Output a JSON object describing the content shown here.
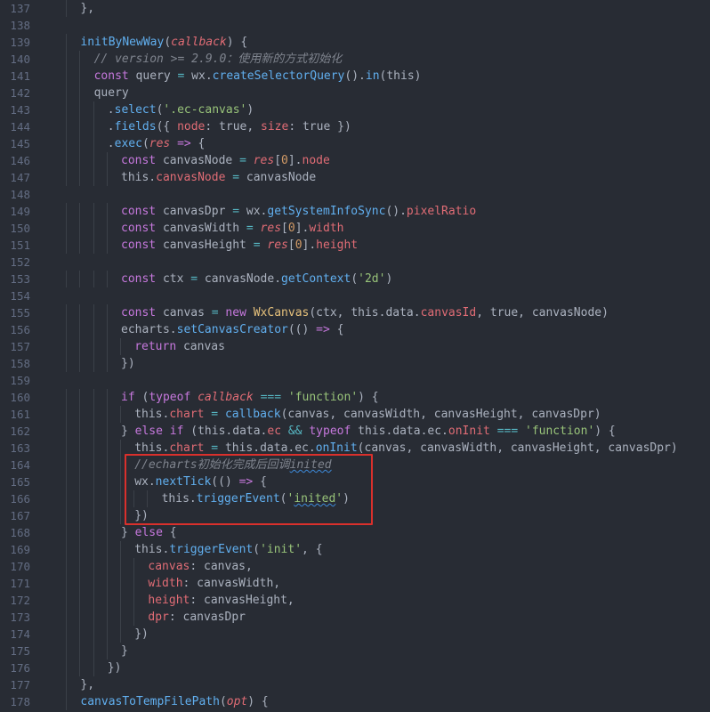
{
  "colors": {
    "background": "#282c34",
    "line_number": "#636d83",
    "keyword": "#c678dd",
    "function": "#61afef",
    "property": "#e06c75",
    "string": "#98c379",
    "number": "#d19a66",
    "comment": "#7f848e",
    "highlight_box": "#d9302c"
  },
  "lines": [
    {
      "n": "137",
      "indent": 2,
      "tokens": [
        [
          "default",
          "},"
        ]
      ]
    },
    {
      "n": "138",
      "indent": 0,
      "tokens": []
    },
    {
      "n": "139",
      "indent": 2,
      "tokens": [
        [
          "function",
          "initByNewWay"
        ],
        [
          "default",
          "("
        ],
        [
          "param",
          "callback"
        ],
        [
          "default",
          ") {"
        ]
      ]
    },
    {
      "n": "140",
      "indent": 3,
      "tokens": [
        [
          "comment",
          "// version >= 2.9.0：使用新的方式初始化"
        ]
      ]
    },
    {
      "n": "141",
      "indent": 3,
      "tokens": [
        [
          "keyword",
          "const"
        ],
        [
          "default",
          " query "
        ],
        [
          "operator",
          "="
        ],
        [
          "default",
          " wx."
        ],
        [
          "function",
          "createSelectorQuery"
        ],
        [
          "default",
          "()."
        ],
        [
          "function",
          "in"
        ],
        [
          "default",
          "(this)"
        ]
      ]
    },
    {
      "n": "142",
      "indent": 3,
      "tokens": [
        [
          "default",
          "query"
        ]
      ]
    },
    {
      "n": "143",
      "indent": 4,
      "tokens": [
        [
          "default",
          "."
        ],
        [
          "function",
          "select"
        ],
        [
          "default",
          "("
        ],
        [
          "string",
          "'.ec-canvas'"
        ],
        [
          "default",
          ")"
        ]
      ]
    },
    {
      "n": "144",
      "indent": 4,
      "tokens": [
        [
          "default",
          "."
        ],
        [
          "function",
          "fields"
        ],
        [
          "default",
          "({ "
        ],
        [
          "property",
          "node"
        ],
        [
          "default",
          ": true, "
        ],
        [
          "property",
          "size"
        ],
        [
          "default",
          ": true })"
        ]
      ]
    },
    {
      "n": "145",
      "indent": 4,
      "tokens": [
        [
          "default",
          "."
        ],
        [
          "function",
          "exec"
        ],
        [
          "default",
          "("
        ],
        [
          "param",
          "res"
        ],
        [
          "default",
          " "
        ],
        [
          "keyword",
          "=>"
        ],
        [
          "default",
          " {"
        ]
      ]
    },
    {
      "n": "146",
      "indent": 5,
      "tokens": [
        [
          "keyword",
          "const"
        ],
        [
          "default",
          " canvasNode "
        ],
        [
          "operator",
          "="
        ],
        [
          "default",
          " "
        ],
        [
          "param",
          "res"
        ],
        [
          "default",
          "["
        ],
        [
          "number",
          "0"
        ],
        [
          "default",
          "]."
        ],
        [
          "property",
          "node"
        ]
      ]
    },
    {
      "n": "147",
      "indent": 5,
      "tokens": [
        [
          "default",
          "this."
        ],
        [
          "property",
          "canvasNode"
        ],
        [
          "default",
          " "
        ],
        [
          "operator",
          "="
        ],
        [
          "default",
          " canvasNode"
        ]
      ]
    },
    {
      "n": "148",
      "indent": 0,
      "tokens": []
    },
    {
      "n": "149",
      "indent": 5,
      "tokens": [
        [
          "keyword",
          "const"
        ],
        [
          "default",
          " canvasDpr "
        ],
        [
          "operator",
          "="
        ],
        [
          "default",
          " wx."
        ],
        [
          "function",
          "getSystemInfoSync"
        ],
        [
          "default",
          "()."
        ],
        [
          "property",
          "pixelRatio"
        ]
      ]
    },
    {
      "n": "150",
      "indent": 5,
      "tokens": [
        [
          "keyword",
          "const"
        ],
        [
          "default",
          " canvasWidth "
        ],
        [
          "operator",
          "="
        ],
        [
          "default",
          " "
        ],
        [
          "param",
          "res"
        ],
        [
          "default",
          "["
        ],
        [
          "number",
          "0"
        ],
        [
          "default",
          "]."
        ],
        [
          "property",
          "width"
        ]
      ]
    },
    {
      "n": "151",
      "indent": 5,
      "tokens": [
        [
          "keyword",
          "const"
        ],
        [
          "default",
          " canvasHeight "
        ],
        [
          "operator",
          "="
        ],
        [
          "default",
          " "
        ],
        [
          "param",
          "res"
        ],
        [
          "default",
          "["
        ],
        [
          "number",
          "0"
        ],
        [
          "default",
          "]."
        ],
        [
          "property",
          "height"
        ]
      ]
    },
    {
      "n": "152",
      "indent": 0,
      "tokens": []
    },
    {
      "n": "153",
      "indent": 5,
      "tokens": [
        [
          "keyword",
          "const"
        ],
        [
          "default",
          " ctx "
        ],
        [
          "operator",
          "="
        ],
        [
          "default",
          " canvasNode."
        ],
        [
          "function",
          "getContext"
        ],
        [
          "default",
          "("
        ],
        [
          "string",
          "'2d'"
        ],
        [
          "default",
          ")"
        ]
      ]
    },
    {
      "n": "154",
      "indent": 0,
      "tokens": []
    },
    {
      "n": "155",
      "indent": 5,
      "tokens": [
        [
          "keyword",
          "const"
        ],
        [
          "default",
          " canvas "
        ],
        [
          "operator",
          "="
        ],
        [
          "default",
          " "
        ],
        [
          "keyword",
          "new"
        ],
        [
          "default",
          " "
        ],
        [
          "class",
          "WxCanvas"
        ],
        [
          "default",
          "(ctx, this.data."
        ],
        [
          "property",
          "canvasId"
        ],
        [
          "default",
          ", true, canvasNode)"
        ]
      ]
    },
    {
      "n": "156",
      "indent": 5,
      "tokens": [
        [
          "default",
          "echarts."
        ],
        [
          "function",
          "setCanvasCreator"
        ],
        [
          "default",
          "(() "
        ],
        [
          "keyword",
          "=>"
        ],
        [
          "default",
          " {"
        ]
      ]
    },
    {
      "n": "157",
      "indent": 6,
      "tokens": [
        [
          "keyword",
          "return"
        ],
        [
          "default",
          " canvas"
        ]
      ]
    },
    {
      "n": "158",
      "indent": 5,
      "tokens": [
        [
          "default",
          "})"
        ]
      ]
    },
    {
      "n": "159",
      "indent": 0,
      "tokens": []
    },
    {
      "n": "160",
      "indent": 5,
      "tokens": [
        [
          "keyword",
          "if"
        ],
        [
          "default",
          " ("
        ],
        [
          "keyword",
          "typeof"
        ],
        [
          "default",
          " "
        ],
        [
          "param",
          "callback"
        ],
        [
          "default",
          " "
        ],
        [
          "operator",
          "==="
        ],
        [
          "default",
          " "
        ],
        [
          "string",
          "'function'"
        ],
        [
          "default",
          ") {"
        ]
      ]
    },
    {
      "n": "161",
      "indent": 6,
      "tokens": [
        [
          "default",
          "this."
        ],
        [
          "property",
          "chart"
        ],
        [
          "default",
          " "
        ],
        [
          "operator",
          "="
        ],
        [
          "default",
          " "
        ],
        [
          "function",
          "callback"
        ],
        [
          "default",
          "(canvas, canvasWidth, canvasHeight, canvasDpr)"
        ]
      ]
    },
    {
      "n": "162",
      "indent": 5,
      "tokens": [
        [
          "default",
          "} "
        ],
        [
          "keyword",
          "else if"
        ],
        [
          "default",
          " (this.data."
        ],
        [
          "property",
          "ec"
        ],
        [
          "default",
          " "
        ],
        [
          "operator",
          "&&"
        ],
        [
          "default",
          " "
        ],
        [
          "keyword",
          "typeof"
        ],
        [
          "default",
          " this.data.ec."
        ],
        [
          "property",
          "onInit"
        ],
        [
          "default",
          " "
        ],
        [
          "operator",
          "==="
        ],
        [
          "default",
          " "
        ],
        [
          "string",
          "'function'"
        ],
        [
          "default",
          ") {"
        ]
      ]
    },
    {
      "n": "163",
      "indent": 6,
      "tokens": [
        [
          "default",
          "this."
        ],
        [
          "property",
          "chart"
        ],
        [
          "default",
          " "
        ],
        [
          "operator",
          "="
        ],
        [
          "default",
          " this.data.ec."
        ],
        [
          "function",
          "onInit"
        ],
        [
          "default",
          "(canvas, canvasWidth, canvasHeight, canvasDpr)"
        ]
      ]
    },
    {
      "n": "164",
      "indent": 6,
      "tokens": [
        [
          "comment",
          "//echarts初始化完成后回调"
        ],
        [
          "comment-squiggle",
          "inited"
        ]
      ]
    },
    {
      "n": "165",
      "indent": 6,
      "tokens": [
        [
          "default",
          "wx."
        ],
        [
          "function",
          "nextTick"
        ],
        [
          "default",
          "(() "
        ],
        [
          "keyword",
          "=>"
        ],
        [
          "default",
          " {"
        ]
      ]
    },
    {
      "n": "166",
      "indent": 8,
      "tokens": [
        [
          "default",
          "this."
        ],
        [
          "function",
          "triggerEvent"
        ],
        [
          "default",
          "("
        ],
        [
          "string",
          "'"
        ],
        [
          "string-squiggle",
          "inited"
        ],
        [
          "string",
          "'"
        ],
        [
          "default",
          ")"
        ]
      ]
    },
    {
      "n": "167",
      "indent": 6,
      "tokens": [
        [
          "default",
          "})"
        ]
      ]
    },
    {
      "n": "168",
      "indent": 5,
      "tokens": [
        [
          "default",
          "} "
        ],
        [
          "keyword",
          "else"
        ],
        [
          "default",
          " {"
        ]
      ]
    },
    {
      "n": "169",
      "indent": 6,
      "tokens": [
        [
          "default",
          "this."
        ],
        [
          "function",
          "triggerEvent"
        ],
        [
          "default",
          "("
        ],
        [
          "string",
          "'init'"
        ],
        [
          "default",
          ", {"
        ]
      ]
    },
    {
      "n": "170",
      "indent": 7,
      "tokens": [
        [
          "property",
          "canvas"
        ],
        [
          "default",
          ": canvas,"
        ]
      ]
    },
    {
      "n": "171",
      "indent": 7,
      "tokens": [
        [
          "property",
          "width"
        ],
        [
          "default",
          ": canvasWidth,"
        ]
      ]
    },
    {
      "n": "172",
      "indent": 7,
      "tokens": [
        [
          "property",
          "height"
        ],
        [
          "default",
          ": canvasHeight,"
        ]
      ]
    },
    {
      "n": "173",
      "indent": 7,
      "tokens": [
        [
          "property",
          "dpr"
        ],
        [
          "default",
          ": canvasDpr"
        ]
      ]
    },
    {
      "n": "174",
      "indent": 6,
      "tokens": [
        [
          "default",
          "})"
        ]
      ]
    },
    {
      "n": "175",
      "indent": 5,
      "tokens": [
        [
          "default",
          "}"
        ]
      ]
    },
    {
      "n": "176",
      "indent": 4,
      "tokens": [
        [
          "default",
          "})"
        ]
      ]
    },
    {
      "n": "177",
      "indent": 2,
      "tokens": [
        [
          "default",
          "},"
        ]
      ]
    },
    {
      "n": "178",
      "indent": 2,
      "tokens": [
        [
          "function",
          "canvasToTempFilePath"
        ],
        [
          "default",
          "("
        ],
        [
          "param",
          "opt"
        ],
        [
          "default",
          ") {"
        ]
      ]
    }
  ]
}
